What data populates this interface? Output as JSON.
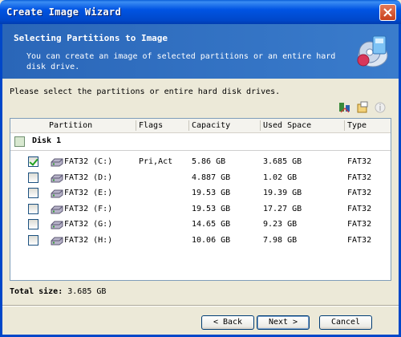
{
  "window": {
    "title": "Create Image Wizard"
  },
  "header": {
    "title": "Selecting Partitions to Image",
    "description": "You can create an image of selected partitions or an entire hard disk drive."
  },
  "prompt": "Please select the partitions or entire hard disk drives.",
  "toolbar_icons": [
    "sort-icon",
    "properties-icon",
    "info-icon"
  ],
  "columns": [
    "Partition",
    "Flags",
    "Capacity",
    "Used Space",
    "Type"
  ],
  "disk": {
    "label": "Disk 1",
    "checked": false
  },
  "partitions": [
    {
      "name": "FAT32  (C:)",
      "flags": "Pri,Act",
      "capacity": "5.86 GB",
      "used": "3.685 GB",
      "type": "FAT32",
      "checked": true
    },
    {
      "name": "FAT32  (D:)",
      "flags": "",
      "capacity": "4.887 GB",
      "used": "1.02 GB",
      "type": "FAT32",
      "checked": false
    },
    {
      "name": "FAT32  (E:)",
      "flags": "",
      "capacity": "19.53 GB",
      "used": "19.39 GB",
      "type": "FAT32",
      "checked": false
    },
    {
      "name": "FAT32  (F:)",
      "flags": "",
      "capacity": "19.53 GB",
      "used": "17.27 GB",
      "type": "FAT32",
      "checked": false
    },
    {
      "name": "FAT32  (G:)",
      "flags": "",
      "capacity": "14.65 GB",
      "used": "9.23 GB",
      "type": "FAT32",
      "checked": false
    },
    {
      "name": "FAT32  (H:)",
      "flags": "",
      "capacity": "10.06 GB",
      "used": "7.98 GB",
      "type": "FAT32",
      "checked": false
    }
  ],
  "total": {
    "label": "Total size:",
    "value": "3.685 GB"
  },
  "buttons": {
    "back": "< Back",
    "next": "Next >",
    "cancel": "Cancel"
  },
  "colors": {
    "title_bar": "#0054e3",
    "header_band": "#2d6fc2",
    "dialog_bg": "#ece9d8"
  }
}
